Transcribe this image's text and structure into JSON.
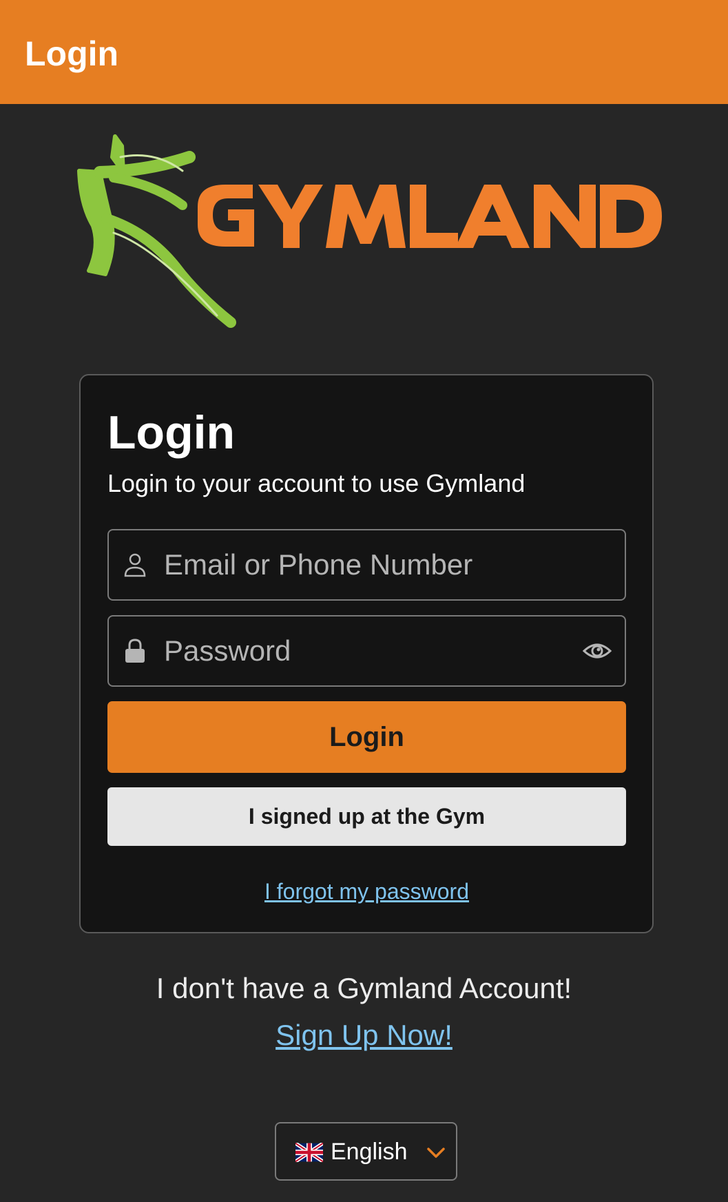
{
  "app_bar": {
    "title": "Login",
    "color": "#e67e22"
  },
  "logo": {
    "brand_text": "GYMLAND",
    "text_color": "#f07f2d",
    "figure_color": "#8dc63f"
  },
  "login_card": {
    "title": "Login",
    "subtitle": "Login to your account to use Gymland",
    "email_field": {
      "placeholder": "Email or Phone Number",
      "value": "",
      "icon": "person-icon"
    },
    "password_field": {
      "placeholder": "Password",
      "value": "",
      "icon": "lock-icon",
      "toggle_icon": "eye-icon"
    },
    "login_button": "Login",
    "gym_signup_button": "I signed up at the Gym",
    "forgot_password_link": "I forgot my password"
  },
  "signup": {
    "prompt": "I don't have a Gymland Account!",
    "link": "Sign Up Now!"
  },
  "language_selector": {
    "flag_icon": "uk-flag-icon",
    "selected": "English",
    "chevron_icon": "chevron-down-icon"
  },
  "colors": {
    "background": "#262626",
    "card": "#141414",
    "accent": "#e67e22",
    "link": "#7fc3ee"
  }
}
